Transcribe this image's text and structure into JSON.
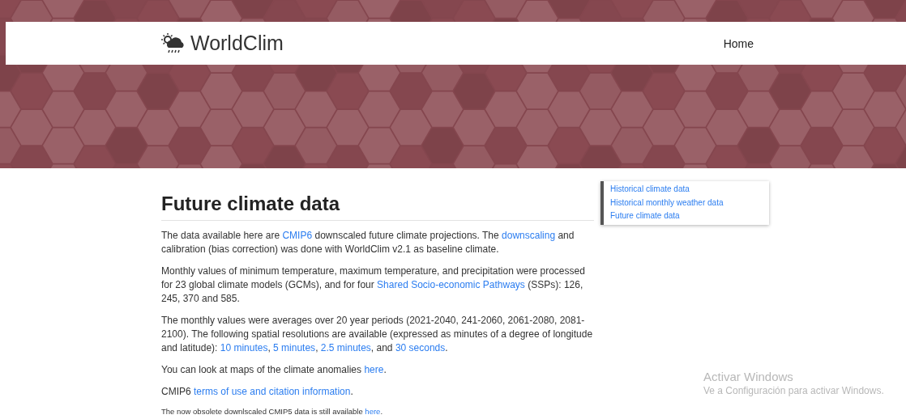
{
  "navbar": {
    "brand": "WorldClim",
    "links": [
      {
        "label": "Home"
      }
    ]
  },
  "main": {
    "title": "Future climate data",
    "paragraphs": [
      {
        "kind": "body",
        "parts": [
          {
            "kind": "text",
            "text": "The data available here are "
          },
          {
            "kind": "link",
            "text": "CMIP6"
          },
          {
            "kind": "text",
            "text": " downscaled future climate projections. The "
          },
          {
            "kind": "link",
            "text": "downscaling"
          },
          {
            "kind": "text",
            "text": " and calibration (bias correction) was done with WorldClim v2.1 as baseline climate."
          }
        ]
      },
      {
        "kind": "body",
        "parts": [
          {
            "kind": "text",
            "text": "Monthly values of minimum temperature, maximum temperature, and precipitation were processed for 23 global climate models (GCMs), and for four "
          },
          {
            "kind": "link",
            "text": "Shared Socio-economic Pathways"
          },
          {
            "kind": "text",
            "text": " (SSPs): 126, 245, 370 and 585."
          }
        ]
      },
      {
        "kind": "body",
        "parts": [
          {
            "kind": "text",
            "text": "The monthly values were averages over 20 year periods (2021-2040, 241-2060, 2061-2080, 2081-2100). The following spatial resolutions are available (expressed as minutes of a degree of longitude and latitude): "
          },
          {
            "kind": "link",
            "text": "10 minutes"
          },
          {
            "kind": "text",
            "text": ", "
          },
          {
            "kind": "link",
            "text": "5 minutes"
          },
          {
            "kind": "text",
            "text": ", "
          },
          {
            "kind": "link",
            "text": "2.5 minutes"
          },
          {
            "kind": "text",
            "text": ", and "
          },
          {
            "kind": "link",
            "text": "30 seconds"
          },
          {
            "kind": "text",
            "text": "."
          }
        ]
      },
      {
        "kind": "body",
        "parts": [
          {
            "kind": "text",
            "text": "You can look at maps of the climate anomalies "
          },
          {
            "kind": "link",
            "text": "here"
          },
          {
            "kind": "text",
            "text": "."
          }
        ]
      },
      {
        "kind": "body",
        "parts": [
          {
            "kind": "text",
            "text": "CMIP6 "
          },
          {
            "kind": "link",
            "text": "terms of use and citation information"
          },
          {
            "kind": "text",
            "text": "."
          }
        ]
      },
      {
        "kind": "note",
        "parts": [
          {
            "kind": "text",
            "text": "The now obsolete downlscaled CMIP5 data is still available "
          },
          {
            "kind": "link",
            "text": "here"
          },
          {
            "kind": "text",
            "text": "."
          }
        ]
      }
    ]
  },
  "sidebar": {
    "links": [
      {
        "label": "Historical climate data"
      },
      {
        "label": "Historical monthly weather data"
      },
      {
        "label": "Future climate data"
      }
    ]
  },
  "os_notice": {
    "title": "Activar Windows",
    "text": "Ve a Configuración para activar Windows."
  }
}
